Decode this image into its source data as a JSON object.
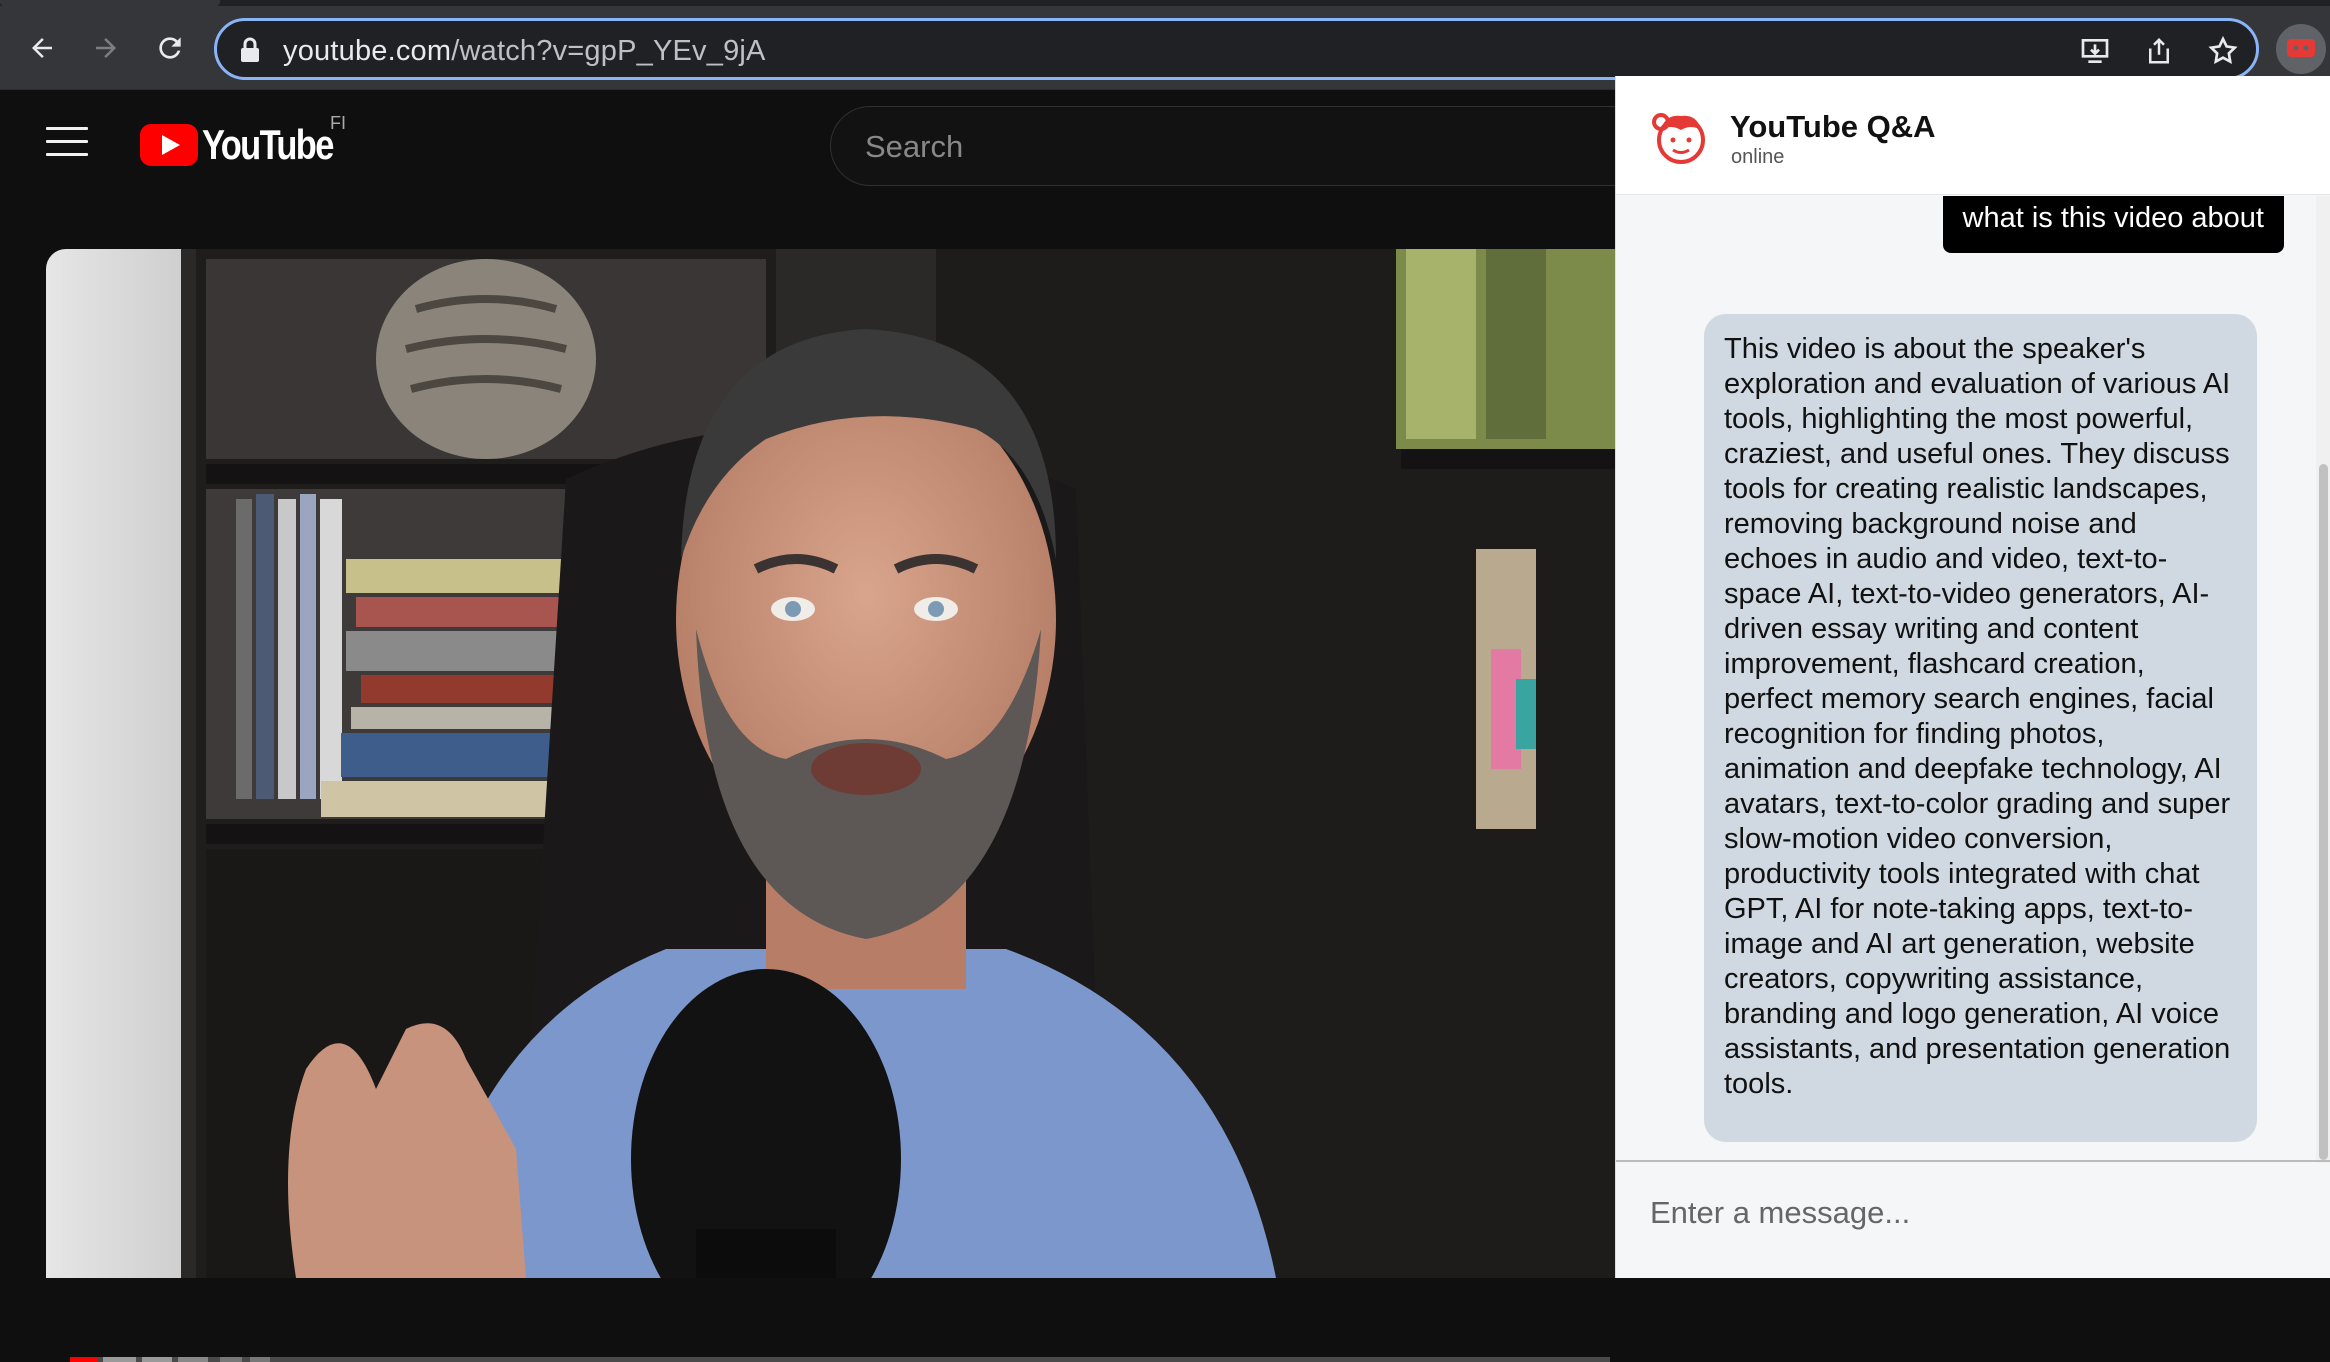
{
  "browser": {
    "url_domain": "youtube.com",
    "url_path": "/watch?v=gpP_YEv_9jA"
  },
  "youtube": {
    "logo_text": "YouTube",
    "country_code": "FI",
    "search_placeholder": "Search"
  },
  "chat": {
    "title": "YouTube Q&A",
    "status": "online",
    "messages": [
      {
        "role": "user",
        "text": "what is this video about"
      },
      {
        "role": "assistant",
        "text": "This video is about the speaker's exploration and evaluation of various AI tools, highlighting the most powerful, craziest, and useful ones. They discuss tools for creating realistic landscapes, removing background noise and echoes in audio and video, text-to-space AI, text-to-video generators, AI-driven essay writing and content improvement, flashcard creation, perfect memory search engines, facial recognition for finding photos, animation and deepfake technology, AI avatars, text-to-color grading and super slow-motion video conversion, productivity tools integrated with chat GPT, AI for note-taking apps, text-to-image and AI art generation, website creators, copywriting assistance, branding and logo generation, AI voice assistants, and presentation generation tools."
      }
    ],
    "input_placeholder": "Enter a message..."
  },
  "colors": {
    "yt_red": "#ff0000",
    "chat_user_bubble": "#000000",
    "chat_bot_bubble": "#d0d9e1",
    "omnibox_focus": "#8ab4f8"
  }
}
